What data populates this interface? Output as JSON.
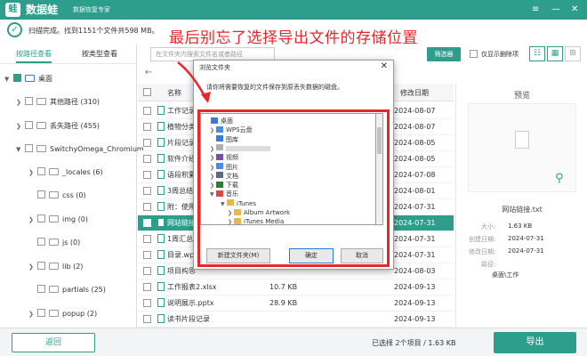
{
  "app": {
    "logo_glyph": "蛙",
    "name": "数据蛙",
    "subtitle": "数据恢复专家"
  },
  "window_controls": {
    "menu": "≡",
    "minimize": "—",
    "close": "✕"
  },
  "scan": {
    "status": "扫描完成。找到1151个文件共598 MB。"
  },
  "headline": "最后别忘了选择导出文件的存储位置",
  "left_tabs": {
    "path_view": "按路径查看",
    "type_view": "按类型查看"
  },
  "tree": [
    {
      "label": "桌面"
    },
    {
      "label": "其他路径 (310)"
    },
    {
      "label": "丢失路径 (455)"
    },
    {
      "label": "SwitchyOmega_Chromium"
    },
    {
      "label": "_locales (6)"
    },
    {
      "label": "css (0)"
    },
    {
      "label": "img (0)"
    },
    {
      "label": "js (0)"
    },
    {
      "label": "lib (2)"
    },
    {
      "label": "partials (25)"
    },
    {
      "label": "popup (2)"
    }
  ],
  "toolbar": {
    "search_placeholder": "在文件夹内搜索文件名或者路径",
    "filter": "筛选器",
    "show_deleted": "仅显示删除项"
  },
  "table": {
    "col_name": "名称",
    "col_modified": "修改日期",
    "rows": [
      {
        "name": "工作记录表",
        "size": "",
        "date": "2024-08-07"
      },
      {
        "name": "植物分类",
        "size": "",
        "date": "2024-08-07"
      },
      {
        "name": "片段记录",
        "size": "",
        "date": "2024-08-05"
      },
      {
        "name": "软件介绍",
        "size": "",
        "date": "2024-08-05"
      },
      {
        "name": "语段积累",
        "size": "",
        "date": "2024-07-08"
      },
      {
        "name": "3周总结",
        "size": "",
        "date": "2024-08-01"
      },
      {
        "name": "附：使用",
        "size": "",
        "date": "2024-07-31"
      },
      {
        "name": "网站链接",
        "size": "",
        "date": "2024-07-31"
      },
      {
        "name": "1周汇总",
        "size": "",
        "date": "2024-07-31"
      },
      {
        "name": "目录.wps",
        "size": "",
        "date": "2024-07-31"
      },
      {
        "name": "项目构思",
        "size": "",
        "date": "2024-08-03"
      },
      {
        "name": "工作报表2.xlsx",
        "size": "10.7 KB",
        "date": "2024-09-13"
      },
      {
        "name": "说明展示.pptx",
        "size": "28.9 KB",
        "date": "2024-09-13"
      },
      {
        "name": "读书片段记录",
        "size": "",
        "date": "2024-09-13"
      }
    ]
  },
  "preview": {
    "title": "预览",
    "filename": "网站链接.txt",
    "size_label": "大小:",
    "size": "1.63 KB",
    "created_label": "创建日期:",
    "created": "2024-07-31",
    "modified_label": "修改日期:",
    "modified": "2024-07-31",
    "path_label": "路径:",
    "path": "桌面\\工作"
  },
  "dialog": {
    "title": "浏览文件夹",
    "close": "✕",
    "message": "请你将需要恢复的文件保存到原丢失数据的磁盘。",
    "items": [
      {
        "label": "桌面",
        "color": "#3a7bd5"
      },
      {
        "label": "WPS云盘",
        "color": "#4a90e2"
      },
      {
        "label": "图库",
        "color": "#3a7bd5"
      },
      {
        "label": "",
        "color": "#b0b0b0"
      },
      {
        "label": "视频",
        "color": "#7b4ea8"
      },
      {
        "label": "图片",
        "color": "#4a90e2"
      },
      {
        "label": "文档",
        "color": "#5b6b7b"
      },
      {
        "label": "下载",
        "color": "#2e7d32"
      },
      {
        "label": "音乐",
        "color": "#d84a4a"
      },
      {
        "label": "iTunes",
        "color": "#e8b84a"
      },
      {
        "label": "Album Artwork",
        "color": "#e8b84a"
      },
      {
        "label": "iTunes Media",
        "color": "#e8b84a"
      }
    ],
    "new_folder": "新建文件夹(M)",
    "ok": "确定",
    "cancel": "取消"
  },
  "bottom": {
    "back": "返回",
    "selected": "已选择 2个项目 / 1.63 KB",
    "export": "导出"
  },
  "colors": {
    "accent": "#2e9e8c",
    "highlight": "#e8272b"
  }
}
